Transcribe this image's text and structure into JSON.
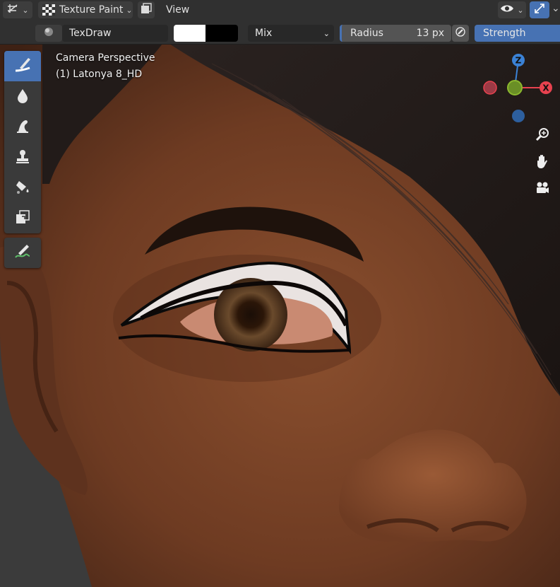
{
  "header": {
    "editor_type_icon": "viewport-axes-icon",
    "mode_label": "Texture Paint",
    "mode_icon": "checker-icon",
    "menu_view": "View",
    "visibility_icon": "eye-icon",
    "gizmo_icon": "gizmo-arrows-icon"
  },
  "tool_settings": {
    "brush_icon": "brush-preview-icon",
    "brush_name": "TexDraw",
    "color_primary": "#ffffff",
    "color_secondary": "#000000",
    "blend_mode": "Mix",
    "radius_label": "Radius",
    "radius_value": "13 px",
    "pressure_icon": "pen-pressure-icon",
    "strength_label": "Strength"
  },
  "viewport": {
    "view_name": "Camera Perspective",
    "object_name": "(1) Latonya 8_HD"
  },
  "toolbar": {
    "tools": [
      {
        "name": "draw-tool",
        "icon": "brush-stroke-icon",
        "active": true
      },
      {
        "name": "soften-tool",
        "icon": "drop-icon",
        "active": false
      },
      {
        "name": "smear-tool",
        "icon": "smear-icon",
        "active": false
      },
      {
        "name": "clone-tool",
        "icon": "stamp-icon",
        "active": false
      },
      {
        "name": "fill-tool",
        "icon": "paint-bucket-icon",
        "active": false
      },
      {
        "name": "mask-tool",
        "icon": "mask-icon",
        "active": false
      }
    ],
    "annotate_icon": "annotate-pen-icon"
  },
  "navigation": {
    "axes": [
      "Z",
      "X"
    ],
    "colors": {
      "x": "#e8424f",
      "y": "#8bb82e",
      "z": "#3b82d6",
      "neg_x": "#9c3a45",
      "neg_z": "#2d5f9e"
    },
    "zoom_icon": "zoom-icon",
    "pan_icon": "hand-icon",
    "camera_icon": "camera-icon"
  }
}
